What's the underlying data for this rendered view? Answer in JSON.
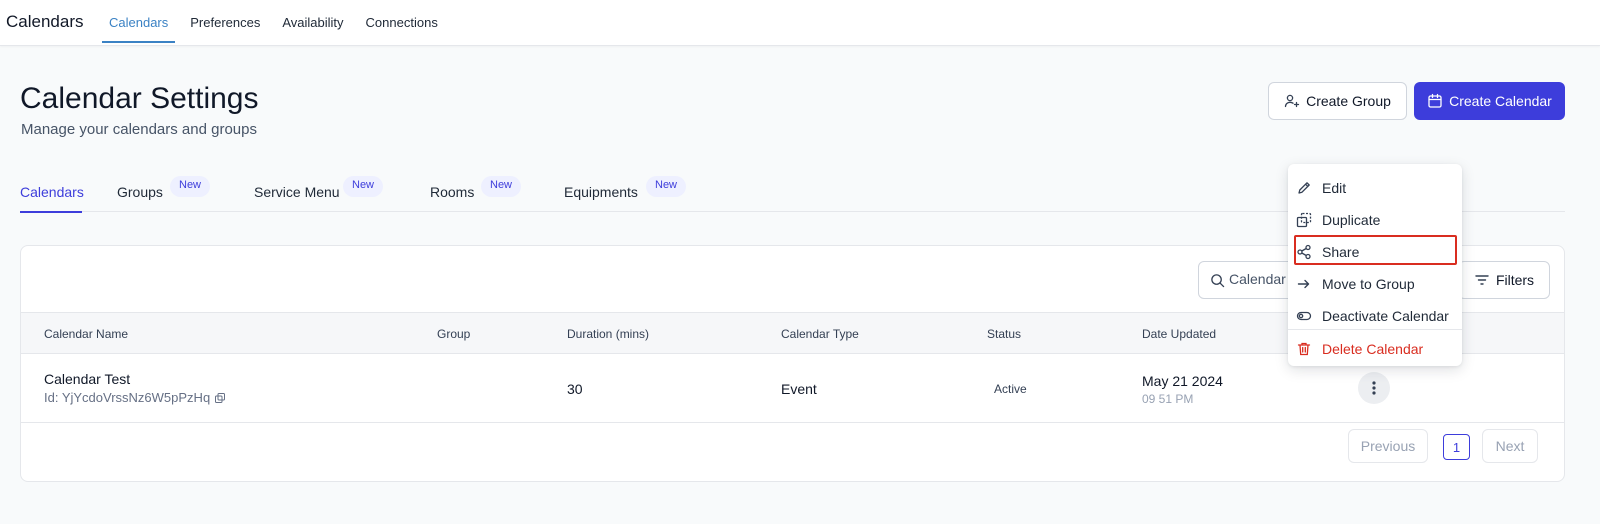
{
  "app": {
    "title": "Calendars"
  },
  "topnav": [
    {
      "label": "Calendars",
      "active": true
    },
    {
      "label": "Preferences"
    },
    {
      "label": "Availability"
    },
    {
      "label": "Connections"
    }
  ],
  "header": {
    "title": "Calendar Settings",
    "subtitle": "Manage your calendars and groups",
    "create_group_label": "Create Group",
    "create_calendar_label": "Create Calendar"
  },
  "tabs": [
    {
      "label": "Calendars",
      "active": true
    },
    {
      "label": "Groups",
      "badge": "New"
    },
    {
      "label": "Service Menu",
      "badge": "New"
    },
    {
      "label": "Rooms",
      "badge": "New"
    },
    {
      "label": "Equipments",
      "badge": "New"
    }
  ],
  "toolbar": {
    "search_placeholder": "Calendar",
    "filters_label": "Filters"
  },
  "table": {
    "columns": [
      "Calendar Name",
      "Group",
      "Duration (mins)",
      "Calendar Type",
      "Status",
      "Date Updated"
    ],
    "rows": [
      {
        "name": "Calendar Test",
        "id": "Id: YjYcdoVrssNz6W5pPzHq",
        "group": "",
        "duration": "30",
        "type": "Event",
        "status": "Active",
        "date": "May 21 2024",
        "time": "09 51 PM"
      }
    ]
  },
  "pagination": {
    "previous": "Previous",
    "page": "1",
    "next": "Next"
  },
  "context_menu": {
    "items": [
      {
        "label": "Edit",
        "icon": "pencil-icon"
      },
      {
        "label": "Duplicate",
        "icon": "duplicate-icon"
      },
      {
        "label": "Share",
        "icon": "share-icon",
        "highlighted": true
      },
      {
        "label": "Move to Group",
        "icon": "arrow-right-icon"
      },
      {
        "label": "Deactivate Calendar",
        "icon": "toggle-icon"
      },
      {
        "label": "Delete Calendar",
        "icon": "trash-icon",
        "danger": true
      }
    ]
  },
  "colors": {
    "primary": "#3d3ddb",
    "nav_active": "#3b82c4",
    "danger": "#d92d20",
    "badge_bg": "#eef0ff"
  }
}
